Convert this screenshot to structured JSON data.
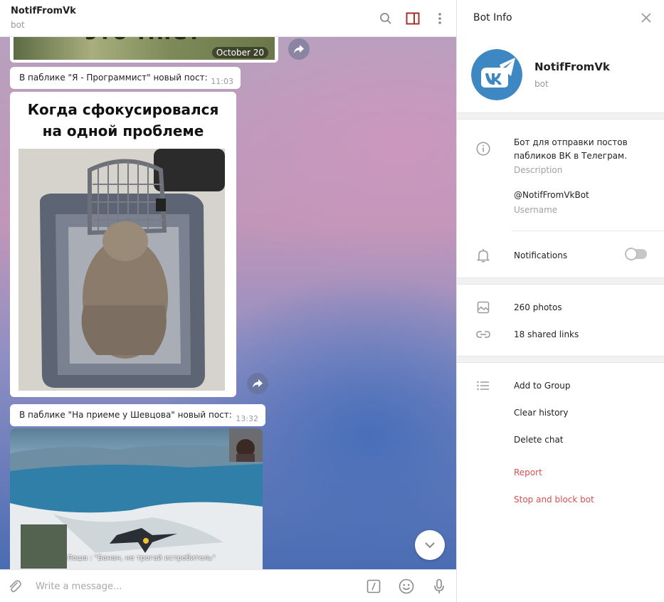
{
  "chat": {
    "title": "NotifFromVk",
    "subtitle": "bot",
    "top_image": {
      "overlay_text": "это мне?",
      "date": "October 20"
    },
    "messages": [
      {
        "text": "В паблике \"Я - Программист\" новый пост:",
        "time": "11:03"
      },
      {
        "text": "В паблике \"На приеме у Шевцова\" новый пост:",
        "time": "13:32"
      }
    ],
    "meme": {
      "caption_line1": "Когда сфокусировался",
      "caption_line2": "на одной проблеме"
    },
    "game_subtitle": "Леша : \"Банан, не трогай истребитель\"",
    "composer_placeholder": "Write a message..."
  },
  "panel": {
    "title": "Bot Info",
    "bot_name": "NotifFromVk",
    "bot_sub": "bot",
    "description": "Бот для отправки постов пабликов ВК в Телеграм.",
    "description_label": "Description",
    "username": "@NotifFromVkBot",
    "username_label": "Username",
    "notifications_label": "Notifications",
    "notifications_enabled": false,
    "photos": "260 photos",
    "links": "18 shared links",
    "actions": [
      "Add to Group",
      "Clear history",
      "Delete chat"
    ],
    "danger_actions": [
      "Report",
      "Stop and block bot"
    ]
  },
  "icons": {
    "header": [
      "search-icon",
      "sidebar-toggle-icon",
      "more-vertical-icon"
    ],
    "composer": [
      "attach-icon",
      "bot-command-icon",
      "emoji-icon",
      "microphone-icon"
    ],
    "panel": [
      "close-icon",
      "info-icon",
      "bell-icon",
      "photo-icon",
      "link-icon",
      "list-icon"
    ]
  },
  "colors": {
    "accent": "#a6322c",
    "danger": "#d2514f",
    "avatar_bg": "#3d88c2"
  }
}
